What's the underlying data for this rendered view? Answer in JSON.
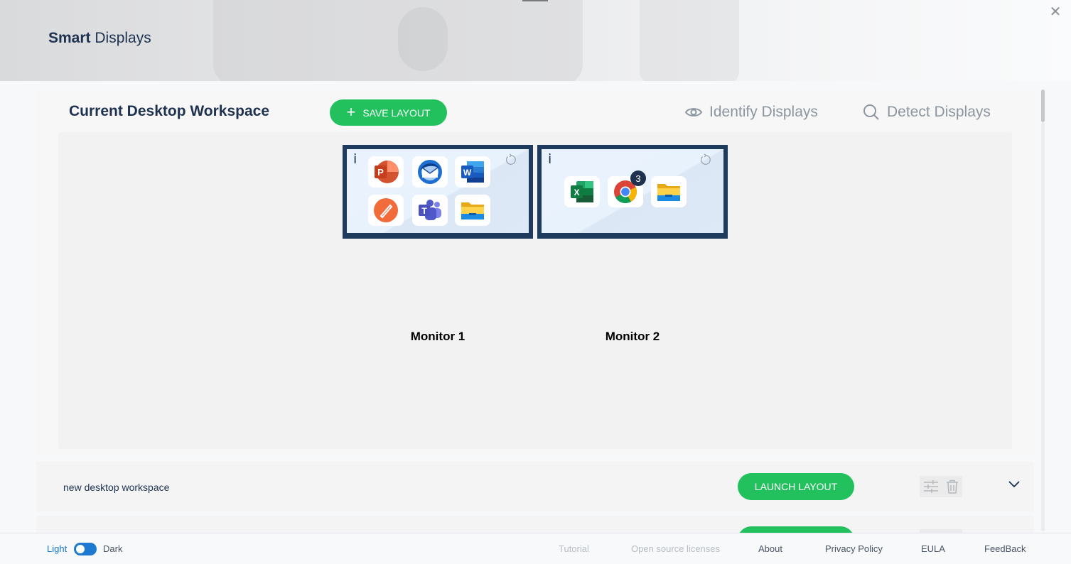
{
  "app": {
    "title_bold": "Smart",
    "title_rest": " Displays",
    "close_glyph": "✕"
  },
  "workspace": {
    "title": "Current Desktop Workspace",
    "save_plus": "+",
    "save_label": "SAVE LAYOUT",
    "identify_label": "Identify Displays",
    "detect_label": "Detect Displays",
    "monitors": [
      {
        "label": "Monitor 1",
        "info_glyph": "i",
        "apps": [
          "powerpoint-icon",
          "thunderbird-icon",
          "word-icon",
          "pen-app-icon",
          "teams-icon",
          "file-explorer-icon"
        ]
      },
      {
        "label": "Monitor 2",
        "info_glyph": "i",
        "apps": [
          "excel-icon",
          "chrome-icon",
          "file-explorer-icon"
        ],
        "chrome_badge": "3"
      }
    ]
  },
  "layouts": [
    {
      "name": "new desktop workspace",
      "launch_label": "LAUNCH LAYOUT"
    },
    {
      "name": "",
      "launch_label": ""
    }
  ],
  "footer": {
    "light_label": "Light",
    "dark_label": "Dark",
    "links": [
      "Tutorial",
      "Open source licenses",
      "About",
      "Privacy Policy",
      "EULA",
      "FeedBack"
    ]
  },
  "colors": {
    "accent_green": "#22c15e",
    "navy": "#1e3250",
    "monitor_frame": "#1e3a5c",
    "toggle_blue": "#1e7ad0"
  }
}
